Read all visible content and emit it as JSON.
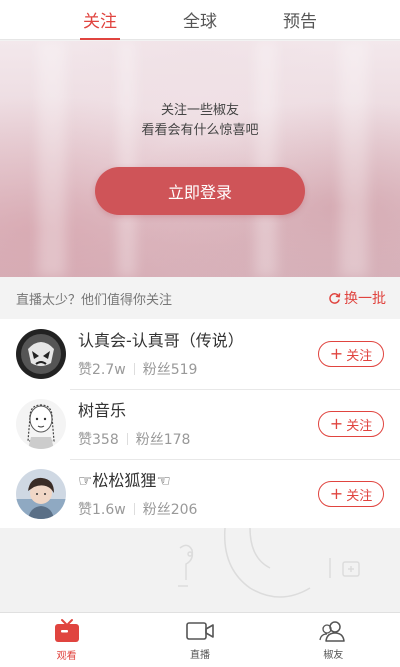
{
  "top_tabs": [
    {
      "label": "关注",
      "active": true
    },
    {
      "label": "全球",
      "active": false
    },
    {
      "label": "预告",
      "active": false
    }
  ],
  "hero": {
    "line1": "关注一些椒友",
    "line2": "看看会有什么惊喜吧",
    "login_label": "立即登录"
  },
  "recommend": {
    "tip": "直播太少？他们值得你关注",
    "refresh_label": "换一批"
  },
  "users": [
    {
      "name": "认真会-认真哥（传说）",
      "likes": "赞2.7w",
      "fans": "粉丝519",
      "follow_label": "关注"
    },
    {
      "name": "树音乐",
      "likes": "赞358",
      "fans": "粉丝178",
      "follow_label": "关注"
    },
    {
      "name": "☞松松狐狸☜",
      "likes": "赞1.6w",
      "fans": "粉丝206",
      "follow_label": "关注"
    }
  ],
  "bottom_nav": [
    {
      "label": "观看",
      "icon": "tv-icon",
      "active": true
    },
    {
      "label": "直播",
      "icon": "camera-icon",
      "active": false
    },
    {
      "label": "椒友",
      "icon": "friends-icon",
      "active": false
    }
  ],
  "colors": {
    "accent": "#e0443f",
    "login_button": "#cf5458"
  }
}
